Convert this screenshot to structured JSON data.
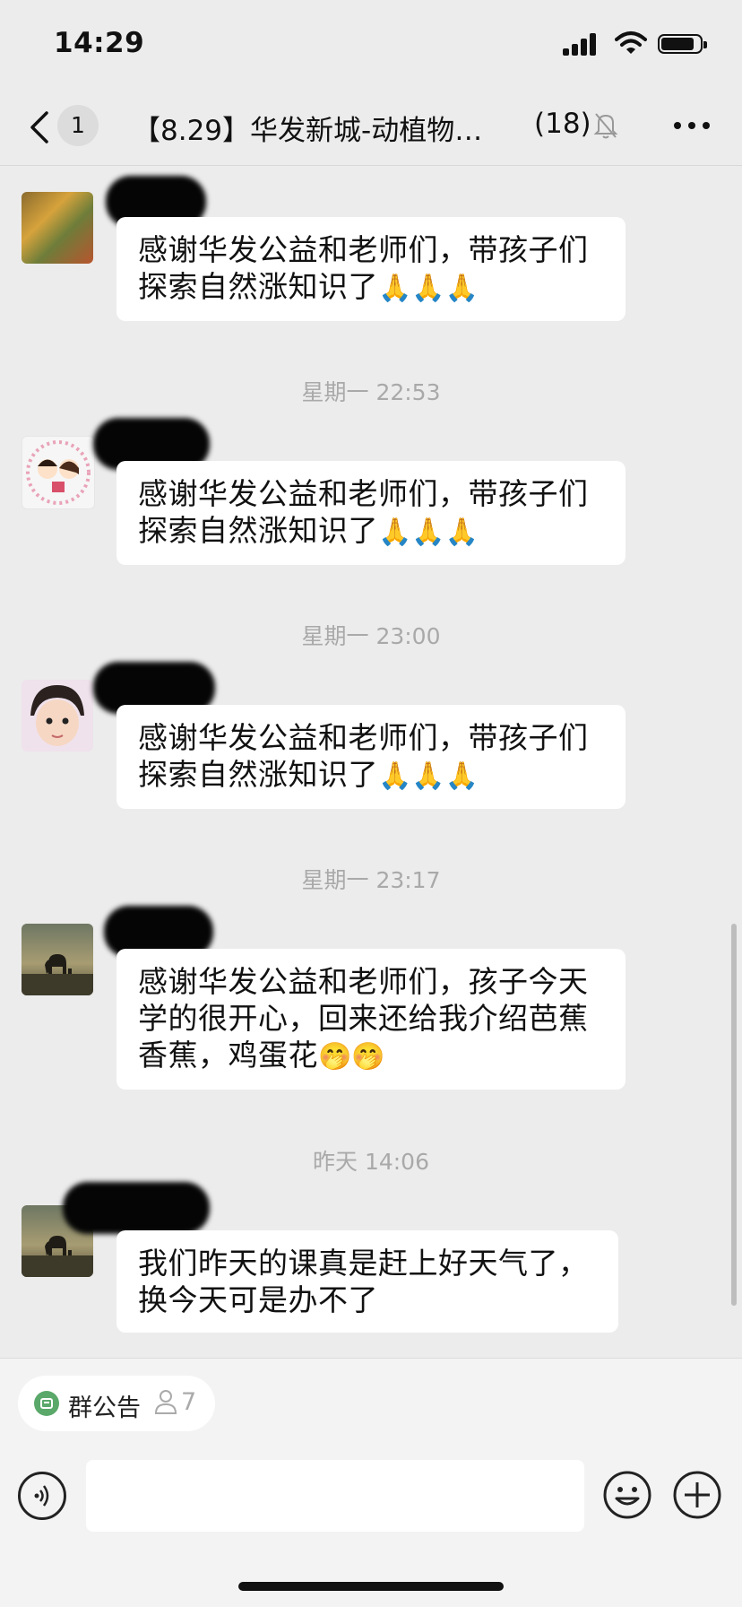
{
  "status_bar": {
    "time": "14:29",
    "signal_icon": "signal-icon",
    "wifi_icon": "wifi-icon",
    "battery_icon": "battery-icon"
  },
  "nav": {
    "back_icon": "chevron-left-icon",
    "unread_count": "1",
    "title": "【8.29】华发新城-动植物…",
    "member_count": "(18)",
    "mute_icon": "bell-off-icon",
    "more_icon": "more-icon"
  },
  "messages": [
    {
      "text_line1": "感谢华发公益和老师们，带孩子们",
      "text_line2": "探索自然涨知识了",
      "emoji": "🙏🙏🙏"
    },
    {
      "text_line1": "感谢华发公益和老师们，带孩子们",
      "text_line2": "探索自然涨知识了",
      "emoji": "🙏🙏🙏"
    },
    {
      "text_line1": "感谢华发公益和老师们，带孩子们",
      "text_line2": "探索自然涨知识了",
      "emoji": "🙏🙏🙏"
    },
    {
      "text_line1": "感谢华发公益和老师们，孩子今天",
      "text_line2": "学的很开心，回来还给我介绍芭蕉",
      "text_line3": "香蕉，鸡蛋花",
      "emoji": "🤭🤭"
    },
    {
      "text_line1": "我们昨天的课真是赶上好天气了，",
      "text_line2": "换今天可是办不了"
    }
  ],
  "timestamps": [
    "星期一 22:53",
    "星期一 23:00",
    "星期一 23:17",
    "昨天 14:06"
  ],
  "bottom": {
    "notice_label": "群公告",
    "notice_count": "7",
    "notice_icon": "announcement-icon",
    "voice_icon": "voice-icon",
    "emoji_icon": "smiley-icon",
    "plus_icon": "plus-icon"
  },
  "colors": {
    "background": "#ececec",
    "bubble": "#ffffff",
    "timestamp": "#a9a9a9",
    "notice_green": "#5aa86a"
  }
}
